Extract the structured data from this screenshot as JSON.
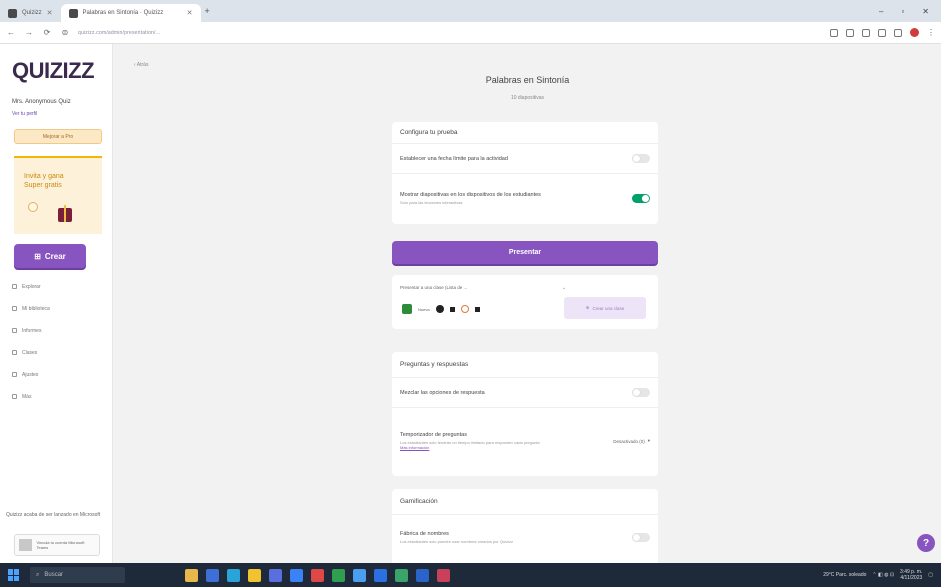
{
  "browser": {
    "tabs": [
      {
        "label": "Quizizz"
      },
      {
        "label": "Palabras en Sintonía · Quizizz"
      }
    ],
    "url": "quizizz.com/admin/presentation/..."
  },
  "sidebar": {
    "logo": "QUIZIZZ",
    "username": "Mrs. Anonymous Quiz",
    "user_link": "Ver tu perfil",
    "upgrade_label": "Mejorar a Pro",
    "promo_text": "Invita y gana Super gratis",
    "create_label": "Crear",
    "nav_items": [
      {
        "label": "Explorar"
      },
      {
        "label": "Mi biblioteca"
      },
      {
        "label": "Informes"
      },
      {
        "label": "Clases"
      },
      {
        "label": "Ajustes"
      },
      {
        "label": "Más"
      }
    ],
    "bottom_text": "Quizizz acaba de ser lanzado en Microsoft",
    "profile_text": "Vincula tu cuenta Microsoft Teams"
  },
  "main": {
    "back_label": "‹ Atrás",
    "title": "Palabras en Sintonía",
    "subtitle": "10 diapositivas",
    "present_label": "Presentar",
    "setup": {
      "heading": "Configura tu prueba",
      "rows": [
        {
          "label": "Establecer una fecha límite para la actividad",
          "sub": "",
          "on": false
        },
        {
          "label": "Mostrar diapositivas en los dispositivos de los estudiantes",
          "sub": "Solo para las lecciones interactivas",
          "on": true
        }
      ]
    },
    "audience": {
      "label": "Presentar a una clase (Lista de ...",
      "caret": "⌄",
      "tag_label": "Nueva",
      "create_class_label": "Crear una clase"
    },
    "questions": {
      "heading": "Preguntas y respuestas",
      "shuffle_label": "Mezclar las opciones de respuesta",
      "timer_label": "Temporizador de preguntas",
      "timer_sub": "Los estudiantes solo tendrán un tiempo limitado para responder cada pregunta",
      "timer_link": "Más información",
      "timer_value": "Desactivado (0)"
    },
    "gamification": {
      "heading": "Gamificación",
      "name_label": "Fábrica de nombres",
      "name_sub": "Los estudiantes solo pueden usar nombres creados por Quizizz"
    }
  },
  "taskbar": {
    "search_label": "Buscar",
    "weather": "29°C  Parc. soleado",
    "time": "3:49 p. m.",
    "date": "4/11/2023"
  },
  "colors": {
    "accent": "#8854c0",
    "toggle_on": "#00a06b"
  }
}
